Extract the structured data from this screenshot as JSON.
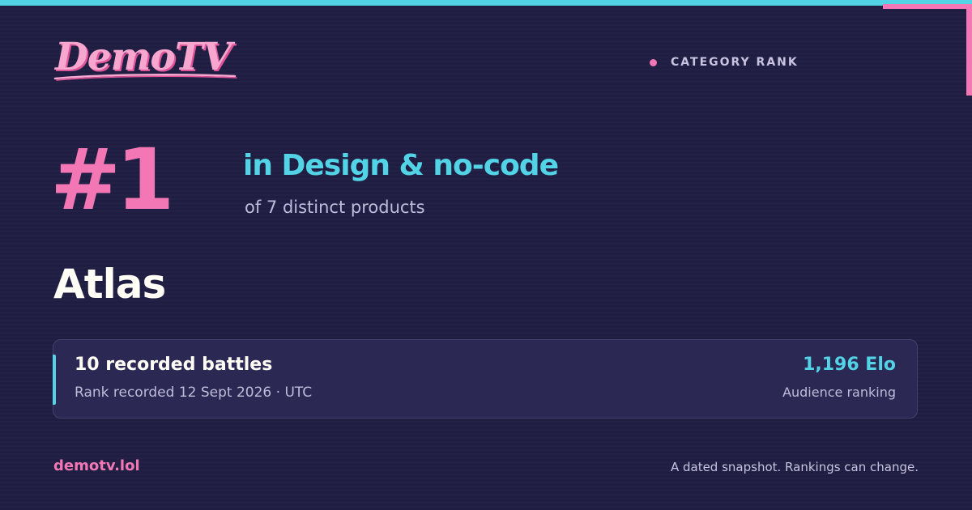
{
  "brand": {
    "logo_text": "DemoTV",
    "domain": "demotv.lol"
  },
  "header": {
    "eyebrow": "CATEGORY RANK"
  },
  "rank": {
    "number": "#1",
    "category": "in Design & no-code",
    "subline": "of 7 distinct products"
  },
  "product": {
    "name": "Atlas"
  },
  "stats": {
    "battles": "10 recorded battles",
    "recorded": "Rank recorded 12 Sept 2026 · UTC",
    "elo": "1,196 Elo",
    "elo_caption": "Audience ranking"
  },
  "footer": {
    "note": "A dated snapshot. Rankings can change."
  },
  "colors": {
    "background": "#1f1e42",
    "accent_pink": "#f277b4",
    "accent_cyan": "#52d3e6",
    "panel": "#2b2953",
    "text_light": "#fffdf6",
    "text_muted": "#bfbbda"
  }
}
